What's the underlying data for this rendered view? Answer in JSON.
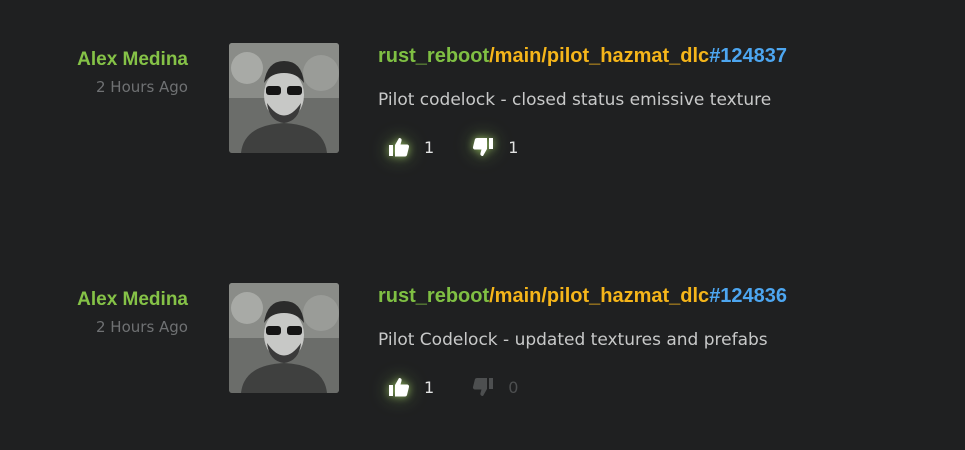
{
  "commits": [
    {
      "author": "Alex Medina",
      "time": "2 Hours Ago",
      "repo": "rust_reboot",
      "path": "/main/pilot_hazmat_dlc",
      "hash": "#124837",
      "message": "Pilot codelock - closed status emissive texture",
      "likes": "1",
      "dislikes": "1"
    },
    {
      "author": "Alex Medina",
      "time": "2 Hours Ago",
      "repo": "rust_reboot",
      "path": "/main/pilot_hazmat_dlc",
      "hash": "#124836",
      "message": "Pilot Codelock - updated textures and prefabs",
      "likes": "1",
      "dislikes": "0"
    }
  ],
  "icons": {
    "like": "thumbs-up-icon",
    "dislike": "thumbs-down-icon"
  },
  "colors": {
    "background": "#1f2021",
    "author": "#85c247",
    "repo": "#7fc043",
    "path": "#f5b51a",
    "hash": "#4da6f0",
    "message": "#c8c9c9",
    "time": "#6f7173"
  }
}
